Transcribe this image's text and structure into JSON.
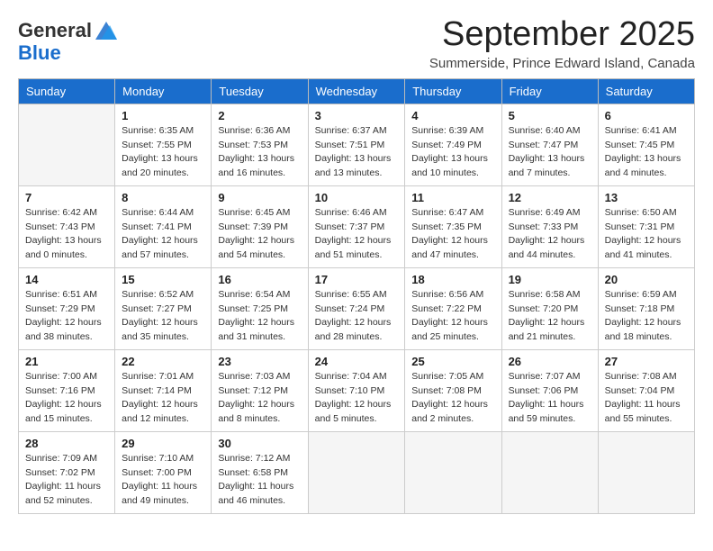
{
  "logo": {
    "general": "General",
    "blue": "Blue"
  },
  "header": {
    "month": "September 2025",
    "location": "Summerside, Prince Edward Island, Canada"
  },
  "days_of_week": [
    "Sunday",
    "Monday",
    "Tuesday",
    "Wednesday",
    "Thursday",
    "Friday",
    "Saturday"
  ],
  "weeks": [
    [
      {
        "day": "",
        "empty": true
      },
      {
        "day": "1",
        "sunrise": "6:35 AM",
        "sunset": "7:55 PM",
        "daylight": "13 hours and 20 minutes."
      },
      {
        "day": "2",
        "sunrise": "6:36 AM",
        "sunset": "7:53 PM",
        "daylight": "13 hours and 16 minutes."
      },
      {
        "day": "3",
        "sunrise": "6:37 AM",
        "sunset": "7:51 PM",
        "daylight": "13 hours and 13 minutes."
      },
      {
        "day": "4",
        "sunrise": "6:39 AM",
        "sunset": "7:49 PM",
        "daylight": "13 hours and 10 minutes."
      },
      {
        "day": "5",
        "sunrise": "6:40 AM",
        "sunset": "7:47 PM",
        "daylight": "13 hours and 7 minutes."
      },
      {
        "day": "6",
        "sunrise": "6:41 AM",
        "sunset": "7:45 PM",
        "daylight": "13 hours and 4 minutes."
      }
    ],
    [
      {
        "day": "7",
        "sunrise": "6:42 AM",
        "sunset": "7:43 PM",
        "daylight": "13 hours and 0 minutes."
      },
      {
        "day": "8",
        "sunrise": "6:44 AM",
        "sunset": "7:41 PM",
        "daylight": "12 hours and 57 minutes."
      },
      {
        "day": "9",
        "sunrise": "6:45 AM",
        "sunset": "7:39 PM",
        "daylight": "12 hours and 54 minutes."
      },
      {
        "day": "10",
        "sunrise": "6:46 AM",
        "sunset": "7:37 PM",
        "daylight": "12 hours and 51 minutes."
      },
      {
        "day": "11",
        "sunrise": "6:47 AM",
        "sunset": "7:35 PM",
        "daylight": "12 hours and 47 minutes."
      },
      {
        "day": "12",
        "sunrise": "6:49 AM",
        "sunset": "7:33 PM",
        "daylight": "12 hours and 44 minutes."
      },
      {
        "day": "13",
        "sunrise": "6:50 AM",
        "sunset": "7:31 PM",
        "daylight": "12 hours and 41 minutes."
      }
    ],
    [
      {
        "day": "14",
        "sunrise": "6:51 AM",
        "sunset": "7:29 PM",
        "daylight": "12 hours and 38 minutes."
      },
      {
        "day": "15",
        "sunrise": "6:52 AM",
        "sunset": "7:27 PM",
        "daylight": "12 hours and 35 minutes."
      },
      {
        "day": "16",
        "sunrise": "6:54 AM",
        "sunset": "7:25 PM",
        "daylight": "12 hours and 31 minutes."
      },
      {
        "day": "17",
        "sunrise": "6:55 AM",
        "sunset": "7:24 PM",
        "daylight": "12 hours and 28 minutes."
      },
      {
        "day": "18",
        "sunrise": "6:56 AM",
        "sunset": "7:22 PM",
        "daylight": "12 hours and 25 minutes."
      },
      {
        "day": "19",
        "sunrise": "6:58 AM",
        "sunset": "7:20 PM",
        "daylight": "12 hours and 21 minutes."
      },
      {
        "day": "20",
        "sunrise": "6:59 AM",
        "sunset": "7:18 PM",
        "daylight": "12 hours and 18 minutes."
      }
    ],
    [
      {
        "day": "21",
        "sunrise": "7:00 AM",
        "sunset": "7:16 PM",
        "daylight": "12 hours and 15 minutes."
      },
      {
        "day": "22",
        "sunrise": "7:01 AM",
        "sunset": "7:14 PM",
        "daylight": "12 hours and 12 minutes."
      },
      {
        "day": "23",
        "sunrise": "7:03 AM",
        "sunset": "7:12 PM",
        "daylight": "12 hours and 8 minutes."
      },
      {
        "day": "24",
        "sunrise": "7:04 AM",
        "sunset": "7:10 PM",
        "daylight": "12 hours and 5 minutes."
      },
      {
        "day": "25",
        "sunrise": "7:05 AM",
        "sunset": "7:08 PM",
        "daylight": "12 hours and 2 minutes."
      },
      {
        "day": "26",
        "sunrise": "7:07 AM",
        "sunset": "7:06 PM",
        "daylight": "11 hours and 59 minutes."
      },
      {
        "day": "27",
        "sunrise": "7:08 AM",
        "sunset": "7:04 PM",
        "daylight": "11 hours and 55 minutes."
      }
    ],
    [
      {
        "day": "28",
        "sunrise": "7:09 AM",
        "sunset": "7:02 PM",
        "daylight": "11 hours and 52 minutes."
      },
      {
        "day": "29",
        "sunrise": "7:10 AM",
        "sunset": "7:00 PM",
        "daylight": "11 hours and 49 minutes."
      },
      {
        "day": "30",
        "sunrise": "7:12 AM",
        "sunset": "6:58 PM",
        "daylight": "11 hours and 46 minutes."
      },
      {
        "day": "",
        "empty": true
      },
      {
        "day": "",
        "empty": true
      },
      {
        "day": "",
        "empty": true
      },
      {
        "day": "",
        "empty": true
      }
    ]
  ]
}
